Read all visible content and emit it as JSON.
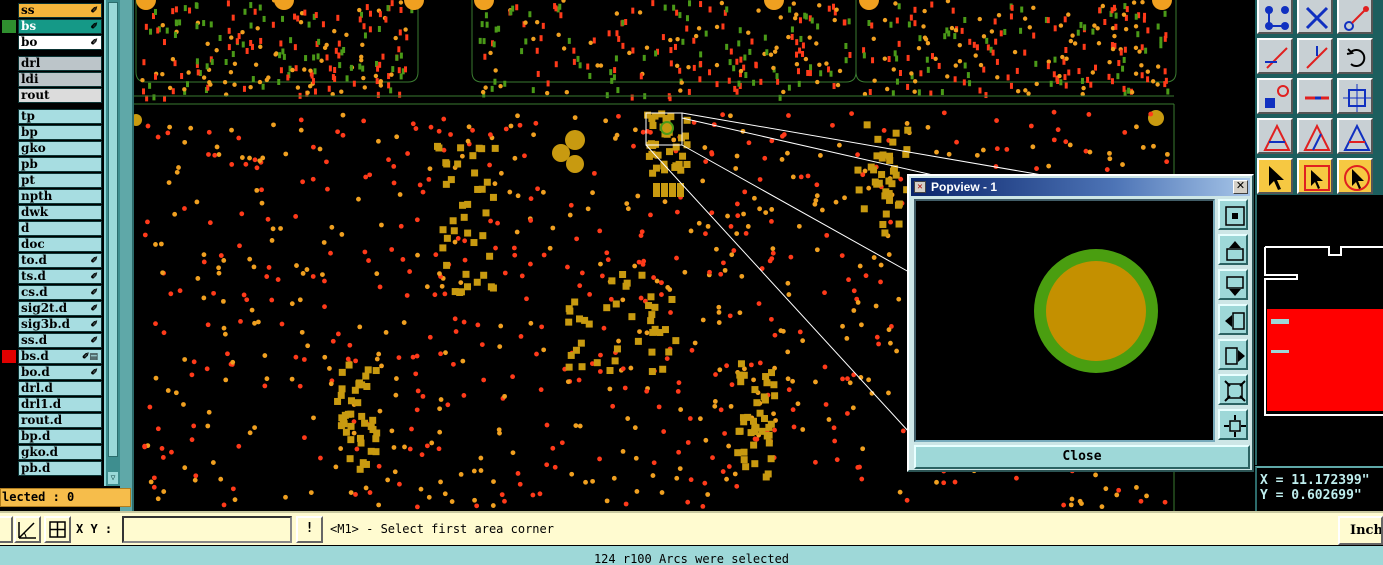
{
  "layers": [
    {
      "name": "ss",
      "style": "hilite-orange",
      "swatch": "#000000",
      "mark": "✐"
    },
    {
      "name": "bs",
      "style": "hilite-teal",
      "swatch": "#2f8f2f",
      "mark": "✐"
    },
    {
      "name": "bo",
      "style": "hilite-white",
      "swatch": "#000000",
      "mark": "✐"
    },
    {
      "name": "drl",
      "style": "hilite-gray",
      "swatch": "#000000",
      "mark": ""
    },
    {
      "name": "ldi",
      "style": "hilite-gray",
      "swatch": "#000000",
      "mark": ""
    },
    {
      "name": "rout",
      "style": "hilite-lgray",
      "swatch": "#000000",
      "mark": ""
    },
    {
      "name": "tp",
      "style": "",
      "swatch": "#000000",
      "mark": ""
    },
    {
      "name": "bp",
      "style": "",
      "swatch": "#000000",
      "mark": ""
    },
    {
      "name": "gko",
      "style": "",
      "swatch": "#000000",
      "mark": ""
    },
    {
      "name": "pb",
      "style": "",
      "swatch": "#000000",
      "mark": ""
    },
    {
      "name": "pt",
      "style": "",
      "swatch": "#000000",
      "mark": ""
    },
    {
      "name": "npth",
      "style": "",
      "swatch": "#000000",
      "mark": ""
    },
    {
      "name": "dwk",
      "style": "",
      "swatch": "#000000",
      "mark": ""
    },
    {
      "name": "d",
      "style": "",
      "swatch": "#000000",
      "mark": ""
    },
    {
      "name": "doc",
      "style": "",
      "swatch": "#000000",
      "mark": ""
    },
    {
      "name": "to.d",
      "style": "",
      "swatch": "#000000",
      "mark": "✐"
    },
    {
      "name": "ts.d",
      "style": "",
      "swatch": "#000000",
      "mark": "✐"
    },
    {
      "name": "cs.d",
      "style": "",
      "swatch": "#000000",
      "mark": "✐"
    },
    {
      "name": "sig2t.d",
      "style": "",
      "swatch": "#000000",
      "mark": "✐"
    },
    {
      "name": "sig3b.d",
      "style": "",
      "swatch": "#000000",
      "mark": "✐"
    },
    {
      "name": "ss.d",
      "style": "",
      "swatch": "#000000",
      "mark": "✐"
    },
    {
      "name": "bs.d",
      "style": "",
      "swatch": "#e00000",
      "mark": "✐▤"
    },
    {
      "name": "bo.d",
      "style": "",
      "swatch": "#000000",
      "mark": "✐"
    },
    {
      "name": "drl.d",
      "style": "",
      "swatch": "#000000",
      "mark": ""
    },
    {
      "name": "drl1.d",
      "style": "",
      "swatch": "#000000",
      "mark": ""
    },
    {
      "name": "rout.d",
      "style": "",
      "swatch": "#000000",
      "mark": ""
    },
    {
      "name": "bp.d",
      "style": "",
      "swatch": "#000000",
      "mark": ""
    },
    {
      "name": "gko.d",
      "style": "",
      "swatch": "#000000",
      "mark": ""
    },
    {
      "name": "pb.d",
      "style": "",
      "swatch": "#000000",
      "mark": ""
    }
  ],
  "selected_label": "lected : 0",
  "coords": {
    "x": "X = 11.172399\"",
    "y": "Y = 0.602699\""
  },
  "command": {
    "xy_label": "X Y :",
    "xy_value": "",
    "exec_label": "!",
    "prompt": "<M1> - Select first area corner",
    "units": "Inch"
  },
  "status": "124 r100 Arcs were selected",
  "popview": {
    "title": "Popview - 1",
    "close_label": "Close",
    "icons": [
      "zoom-fit-icon",
      "pan-up-icon",
      "pan-down-icon",
      "pan-left-icon",
      "pan-right-icon",
      "zoom-in-icon",
      "zoom-out-icon"
    ]
  },
  "tools": [
    "select-connected-icon",
    "cross-select-icon",
    "net-select-icon",
    "line-select-icon",
    "line-edit-icon",
    "rotate-icon",
    "pad-select-icon",
    "minus-icon",
    "area-fit-icon",
    "triangle-inside-icon",
    "triangle-cross-icon",
    "triangle-outside-icon",
    "pointer-icon",
    "pointer-box-icon",
    "pointer-circle-icon"
  ],
  "colors": {
    "pad": "#f0a020",
    "pad_dark": "#d08020",
    "red_dot": "#ff3a1a",
    "green": "#4a9a18",
    "smd": "#c89a10",
    "outline": "#3a7a30",
    "popview_outer": "#4a9e10",
    "popview_inner": "#c49000"
  }
}
